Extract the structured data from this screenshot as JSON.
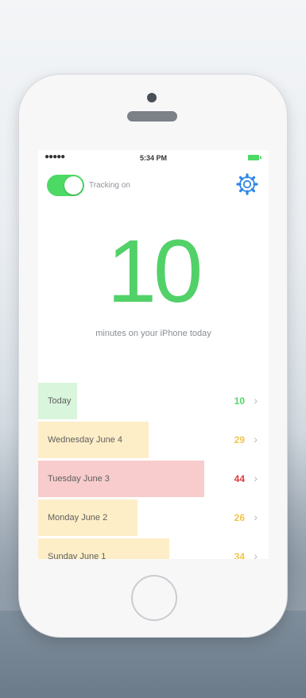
{
  "status_bar": {
    "signal": "●●●●●",
    "time": "5:34 PM"
  },
  "header": {
    "tracking_label": "Tracking on",
    "toggle_on": true,
    "settings_icon": "gear-icon"
  },
  "summary": {
    "minutes": "10",
    "caption": "minutes on your iPhone today"
  },
  "days": [
    {
      "label": "Today",
      "value": "10",
      "color": "#4cd964",
      "fill": "#d9f5dc",
      "fraction": 0.17
    },
    {
      "label": "Wednesday June 4",
      "value": "29",
      "color": "#f2c44b",
      "fill": "#fdeec7",
      "fraction": 0.48
    },
    {
      "label": "Tuesday June 3",
      "value": "44",
      "color": "#e03b3b",
      "fill": "#f8cccc",
      "fraction": 0.72
    },
    {
      "label": "Monday June 2",
      "value": "26",
      "color": "#f2c44b",
      "fill": "#fdeec7",
      "fraction": 0.43
    },
    {
      "label": "Sunday June 1",
      "value": "34",
      "color": "#f2c44b",
      "fill": "#fdeec7",
      "fraction": 0.57
    }
  ],
  "colors": {
    "accent_green": "#4cd964",
    "number_green": "#52d168"
  }
}
